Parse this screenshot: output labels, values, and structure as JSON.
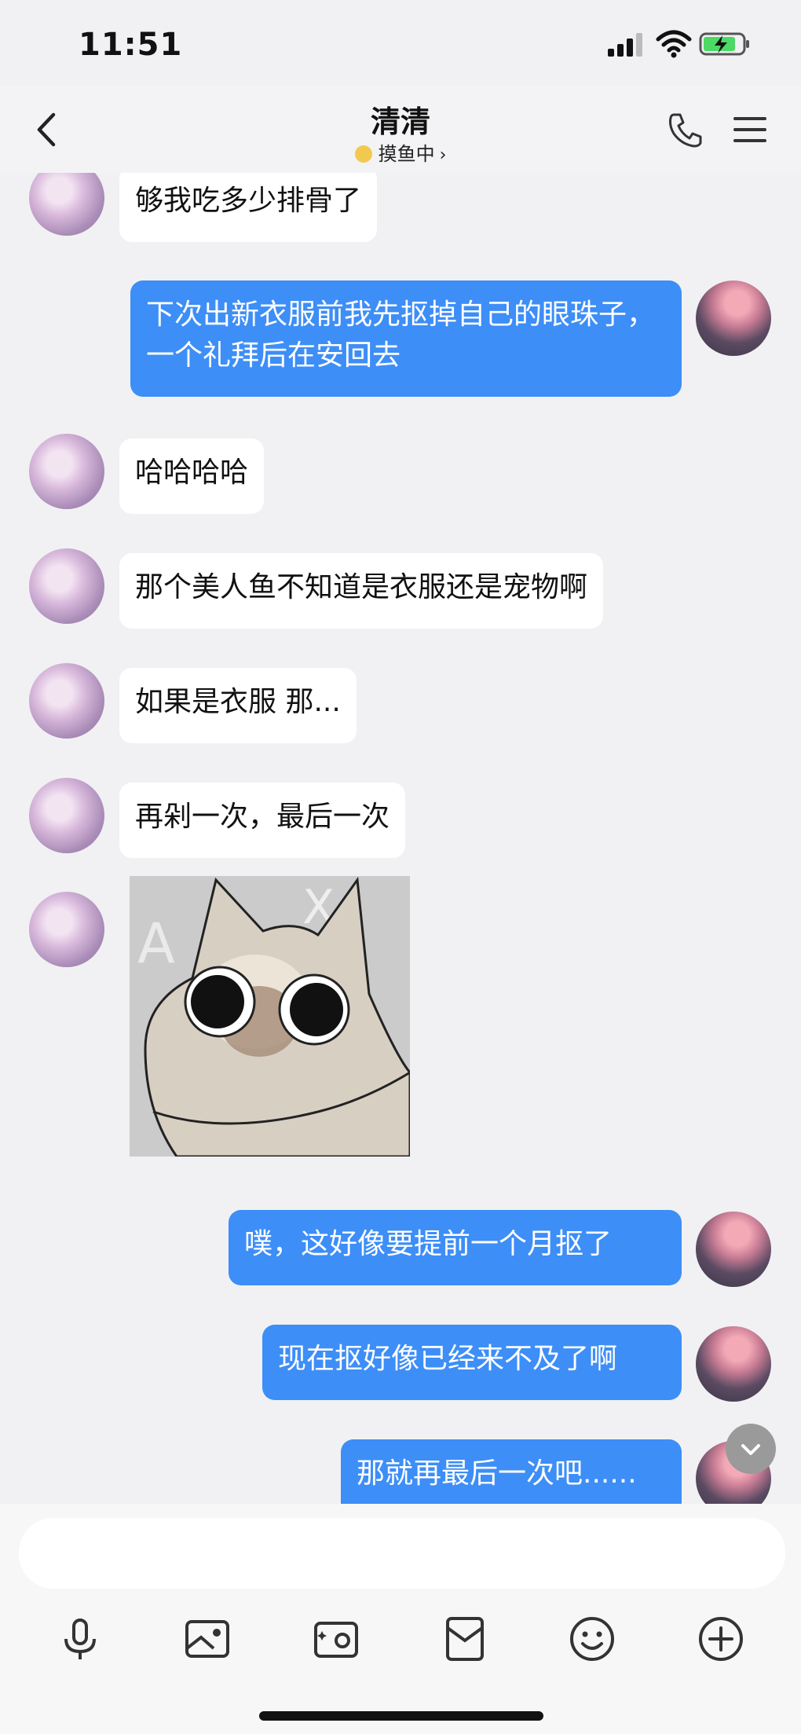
{
  "status": {
    "time": "11:51"
  },
  "header": {
    "title": "清清",
    "status_text": "摸鱼中"
  },
  "messages": [
    {
      "side": "in",
      "text": "够我吃多少排骨了"
    },
    {
      "side": "out",
      "text": "下次出新衣服前我先抠掉自己的眼珠子，一个礼拜后在安回去"
    },
    {
      "side": "in",
      "text": "哈哈哈哈"
    },
    {
      "side": "in",
      "text": "那个美人鱼不知道是衣服还是宠物啊"
    },
    {
      "side": "in",
      "text": "如果是衣服 那..."
    },
    {
      "side": "in",
      "text": "再剁一次，最后一次"
    },
    {
      "side": "in",
      "type": "sticker",
      "description": "siamese-cat-sticker"
    },
    {
      "side": "out",
      "text": "噗，这好像要提前一个月抠了"
    },
    {
      "side": "out",
      "text": "现在抠好像已经来不及了啊"
    },
    {
      "side": "out",
      "text": "那就再最后一次吧......"
    }
  ],
  "composer": {
    "input_value": "",
    "tools": [
      "microphone-icon",
      "image-icon",
      "camera-icon",
      "red-packet-icon",
      "emoji-icon",
      "plus-icon"
    ]
  },
  "colors": {
    "outgoing_bubble": "#3d8ef7",
    "incoming_bubble": "#ffffff",
    "background": "#f1f1f3"
  }
}
